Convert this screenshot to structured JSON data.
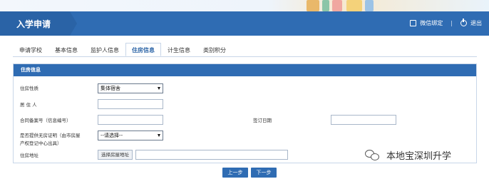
{
  "header": {
    "title": "入学申请",
    "wechat_bind": "微信绑定",
    "separator": "|",
    "logout": "退出"
  },
  "tabs": [
    {
      "label": "申请学校",
      "active": false
    },
    {
      "label": "基本信息",
      "active": false
    },
    {
      "label": "监护人信息",
      "active": false
    },
    {
      "label": "住房信息",
      "active": true
    },
    {
      "label": "计生信息",
      "active": false
    },
    {
      "label": "类别积分",
      "active": false
    }
  ],
  "panel": {
    "title": "住房信息",
    "housing_type_label": "住房性质",
    "housing_type_value": "集体宿舍",
    "resident_label": "居 住 人",
    "resident_value": "",
    "contract_label": "合同备案号（信息编号）",
    "contract_value": "",
    "sign_date_label": "签订日期",
    "sign_date_value": "",
    "proof_label_line1": "是否提供无房证明（由市房屋",
    "proof_label_line2": "产权登记中心出具）",
    "proof_value": "--请选择--",
    "address_label": "住房地址",
    "address_button": "选择房屋地址",
    "address_value": ""
  },
  "nav": {
    "prev": "上一步",
    "next": "下一步"
  },
  "watermark": {
    "text": "本地宝深圳升学"
  },
  "colors": {
    "primary": "#2f6cb3",
    "primary_dark": "#2a63a6"
  }
}
